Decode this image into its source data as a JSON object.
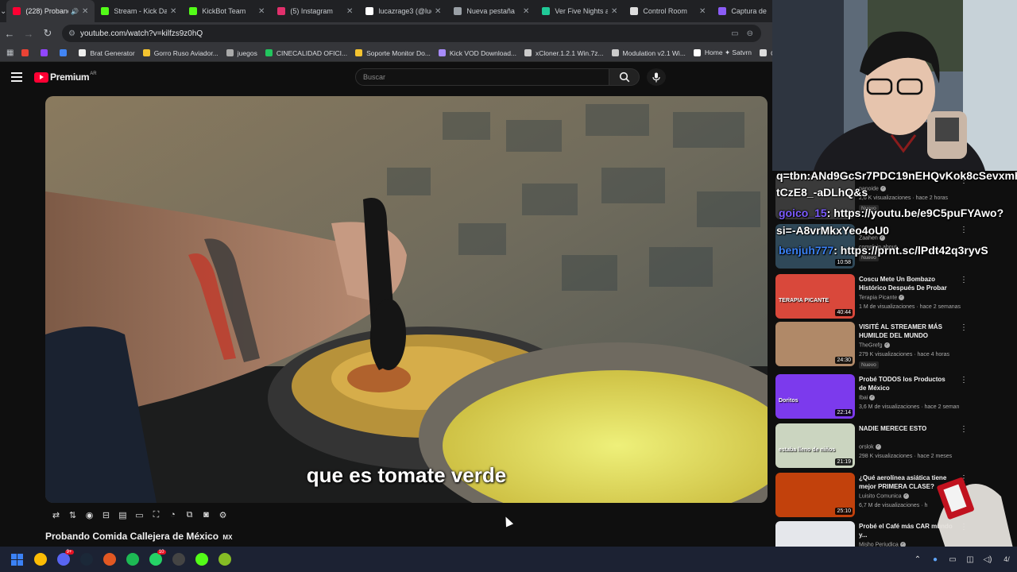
{
  "browser": {
    "tabs": [
      {
        "label": "(228) Probando",
        "color": "#ff0033",
        "active": true
      },
      {
        "label": "Stream - Kick Da",
        "color": "#53fc18"
      },
      {
        "label": "KickBot Team",
        "color": "#53fc18"
      },
      {
        "label": "(5) Instagram",
        "color": "#e1306c"
      },
      {
        "label": "lucazrage3 (@luc",
        "color": "#ffffff"
      },
      {
        "label": "Nueva pestaña",
        "color": "#9aa0a6"
      },
      {
        "label": "Ver Five Nights at",
        "color": "#20c997"
      },
      {
        "label": "Control Room",
        "color": "#dddddd"
      },
      {
        "label": "Captura de",
        "color": "#8b5cf6"
      }
    ],
    "url": "youtube.com/watch?v=kilfzs9z0hQ",
    "bookmarks": [
      {
        "label": "",
        "color": "#ea4335"
      },
      {
        "label": "",
        "color": "#9146ff"
      },
      {
        "label": "",
        "color": "#4285f4"
      },
      {
        "label": "Brat Generator",
        "color": "#eeeeee"
      },
      {
        "label": "Gorro Ruso Aviador...",
        "color": "#f4c430"
      },
      {
        "label": "juegos",
        "color": "#aaaaaa"
      },
      {
        "label": "CINECALIDAD OFICI...",
        "color": "#22c55e"
      },
      {
        "label": "Soporte Monitor Do...",
        "color": "#f4c430"
      },
      {
        "label": "Kick VOD Download...",
        "color": "#a78bfa"
      },
      {
        "label": "xCloner.1.2.1 Win.7z...",
        "color": "#cccccc"
      },
      {
        "label": "Modulation v2.1 Wi...",
        "color": "#cccccc"
      },
      {
        "label": "Home ✦ Satvrn",
        "color": "#ffffff"
      },
      {
        "label": "Control",
        "color": "#dddddd"
      }
    ]
  },
  "youtube": {
    "logo": "Premium",
    "country": "AR",
    "search_placeholder": "Buscar",
    "subtitle": "que es tomate verde",
    "video_title": "Probando Comida Callejera de México",
    "video_title_flag": "MX"
  },
  "overlay_chat": [
    {
      "text": "q=tbn:ANd9GcSr7PDC19nEHQvKok8cSevxmH",
      "user": "",
      "color": "#ffffff"
    },
    {
      "text": "tCzE8_-aDLhQ&s",
      "user": "",
      "color": "#ffffff"
    },
    {
      "user": "goico_15",
      "text": ": https://youtu.be/e9C5puFYAwo?",
      "color": "#7c5cff"
    },
    {
      "text": "si=-A8vrMkxYeo4oU0",
      "user": "",
      "color": "#ffffff"
    },
    {
      "user": "benjuh777",
      "text": ": https://prnt.sc/lPdt42q3ryvS",
      "color": "#3b82f6"
    }
  ],
  "recommendations": [
    {
      "title": "",
      "channel": "panoide",
      "meta": "2,6 K visualizaciones · hace 2 horas",
      "badge": "Nuevo",
      "duration": "",
      "thumb": "#3a3a3a",
      "partial": true
    },
    {
      "title": "",
      "channel": "Zaahen",
      "meta": "complain about",
      "badge": "Nuevo",
      "duration": "10:58",
      "thumb": "#2f4858",
      "partial": true
    },
    {
      "title": "Coscu Mete Un Bombazo Histórico Después De Probar ...",
      "channel": "Terapia Picante",
      "meta": "1 M de visualizaciones · hace 2 semanas",
      "badge": "",
      "duration": "40:44",
      "thumb": "#d9483b",
      "thumb_text": "TERAPIA PICANTE"
    },
    {
      "title": "VISITÉ AL STREAMER MÁS HUMILDE DEL MUNDO",
      "channel": "TheGrefg",
      "meta": "279 K visualizaciones · hace 4 horas",
      "badge": "Nuevo",
      "duration": "24:30",
      "thumb": "#b08968"
    },
    {
      "title": "Probé TODOS los Productos de México",
      "channel": "Ibai",
      "meta": "3,6 M de visualizaciones · hace 2 seman",
      "badge": "",
      "duration": "22:14",
      "thumb": "#7c3aed",
      "thumb_text": "Doritos"
    },
    {
      "title": "NADIE MERECE ESTO",
      "channel": "orslok",
      "meta": "298 K visualizaciones · hace 2 meses",
      "badge": "",
      "duration": "21:19",
      "thumb": "#cbd5c0",
      "thumb_text": "estaba lleno de niños"
    },
    {
      "title": "¿Qué aerolínea asiática tiene mejor PRIMERA CLASE?",
      "channel": "Luisito Comunica",
      "meta": "6,7 M de visualizaciones · h",
      "badge": "",
      "duration": "25:10",
      "thumb": "#c2410c"
    },
    {
      "title": "Probé el Café más CAR mundo y...",
      "channel": "Misho Periudica",
      "meta": "",
      "badge": "",
      "duration": "",
      "thumb": "#e5e7eb"
    }
  ],
  "taskbar": {
    "apps": [
      {
        "name": "windows-start",
        "color": "#3b82f6"
      },
      {
        "name": "chrome",
        "color": "#fbbc05"
      },
      {
        "name": "discord",
        "color": "#5865f2",
        "badge": "9+"
      },
      {
        "name": "steam",
        "color": "#1b2838"
      },
      {
        "name": "app-orange",
        "color": "#e25822"
      },
      {
        "name": "spotify",
        "color": "#1db954"
      },
      {
        "name": "whatsapp",
        "color": "#25d366",
        "badge": "10"
      },
      {
        "name": "obs",
        "color": "#444444"
      },
      {
        "name": "kick",
        "color": "#53fc18"
      },
      {
        "name": "xbox",
        "color": "#86bc25"
      }
    ],
    "time": "4/"
  }
}
